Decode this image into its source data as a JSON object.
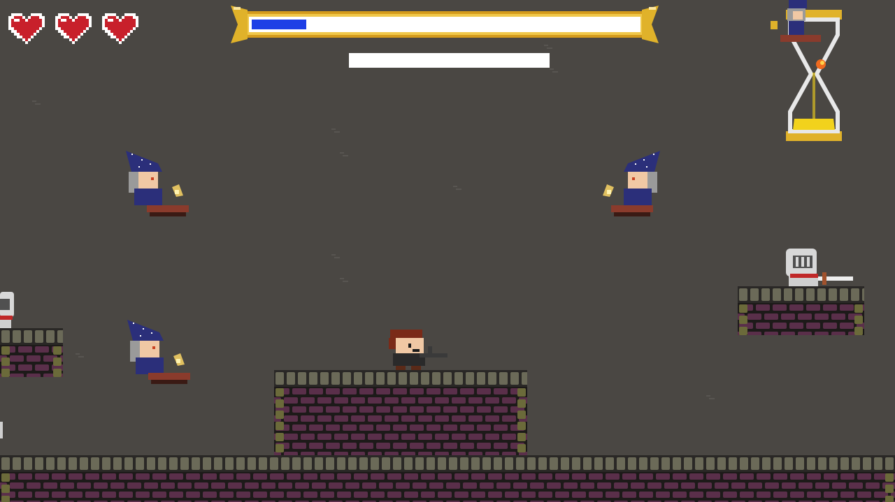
{
  "hud": {
    "hearts": [
      {
        "name": "heart-icon",
        "state": "full"
      },
      {
        "name": "heart-icon",
        "state": "full"
      },
      {
        "name": "heart-icon",
        "state": "full"
      }
    ],
    "progress": {
      "fraction": 0.14,
      "fill_color": "#1e3fe6",
      "frame_color": "#e0b22a"
    },
    "hourglass": {
      "icon": "hourglass-icon",
      "sand_color": "#f2d21c"
    }
  },
  "colors": {
    "background": "#4a4743",
    "brick_face": "#5a2f4a",
    "brick_mortar": "#1d1a19",
    "stone_top": "#6b6a58",
    "wizard_hat": "#2b2f7a"
  },
  "entities": [
    {
      "type": "wizard",
      "icon": "wizard-on-carpet-icon",
      "facing": "right"
    },
    {
      "type": "wizard",
      "icon": "wizard-on-carpet-icon",
      "facing": "left"
    },
    {
      "type": "wizard",
      "icon": "wizard-on-carpet-icon",
      "facing": "right"
    },
    {
      "type": "knight",
      "icon": "knight-with-sword-icon",
      "facing": "right"
    },
    {
      "type": "knight",
      "icon": "knight-icon",
      "facing": "right"
    },
    {
      "type": "player",
      "icon": "gunner-player-icon",
      "facing": "right"
    }
  ]
}
